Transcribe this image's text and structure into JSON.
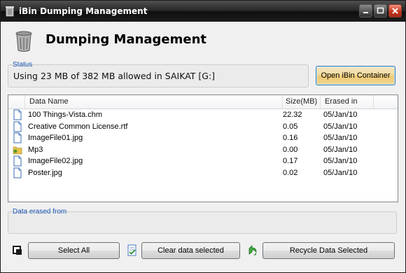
{
  "window": {
    "title": "iBin Dumping Management"
  },
  "header": {
    "title": "Dumping Management"
  },
  "status": {
    "group_label": "Status",
    "text": "Using 23 MB of 382 MB allowed in SAIKAT [G:]",
    "used_mb": 23,
    "allowed_mb": 382,
    "drive": "SAIKAT [G:]"
  },
  "open_button": {
    "label": "Open iBin Container"
  },
  "table": {
    "columns": [
      "Data Name",
      "Size(MB)",
      "Erased in"
    ],
    "rows": [
      {
        "icon": "document-icon",
        "name": "100 Things-Vista.chm",
        "size": "22.32",
        "erased": "05/Jan/10"
      },
      {
        "icon": "document-icon",
        "name": "Creative Common License.rtf",
        "size": "0.05",
        "erased": "05/Jan/10"
      },
      {
        "icon": "document-icon",
        "name": "ImageFile01.jpg",
        "size": "0.16",
        "erased": "05/Jan/10"
      },
      {
        "icon": "folder-icon",
        "name": "Mp3",
        "size": "0.00",
        "erased": "05/Jan/10"
      },
      {
        "icon": "document-icon",
        "name": "ImageFile02.jpg",
        "size": "0.17",
        "erased": "05/Jan/10"
      },
      {
        "icon": "document-icon",
        "name": "Poster.jpg",
        "size": "0.02",
        "erased": "05/Jan/10"
      }
    ]
  },
  "erased_from": {
    "group_label": "Data erased from"
  },
  "buttons": {
    "select_all": "Select All",
    "clear": "Clear data selected",
    "recycle": "Recycle Data Selected"
  },
  "colors": {
    "accent_label": "#1a56b4",
    "title_bar": "#1c1c1c",
    "close_button": "#c5351c"
  }
}
